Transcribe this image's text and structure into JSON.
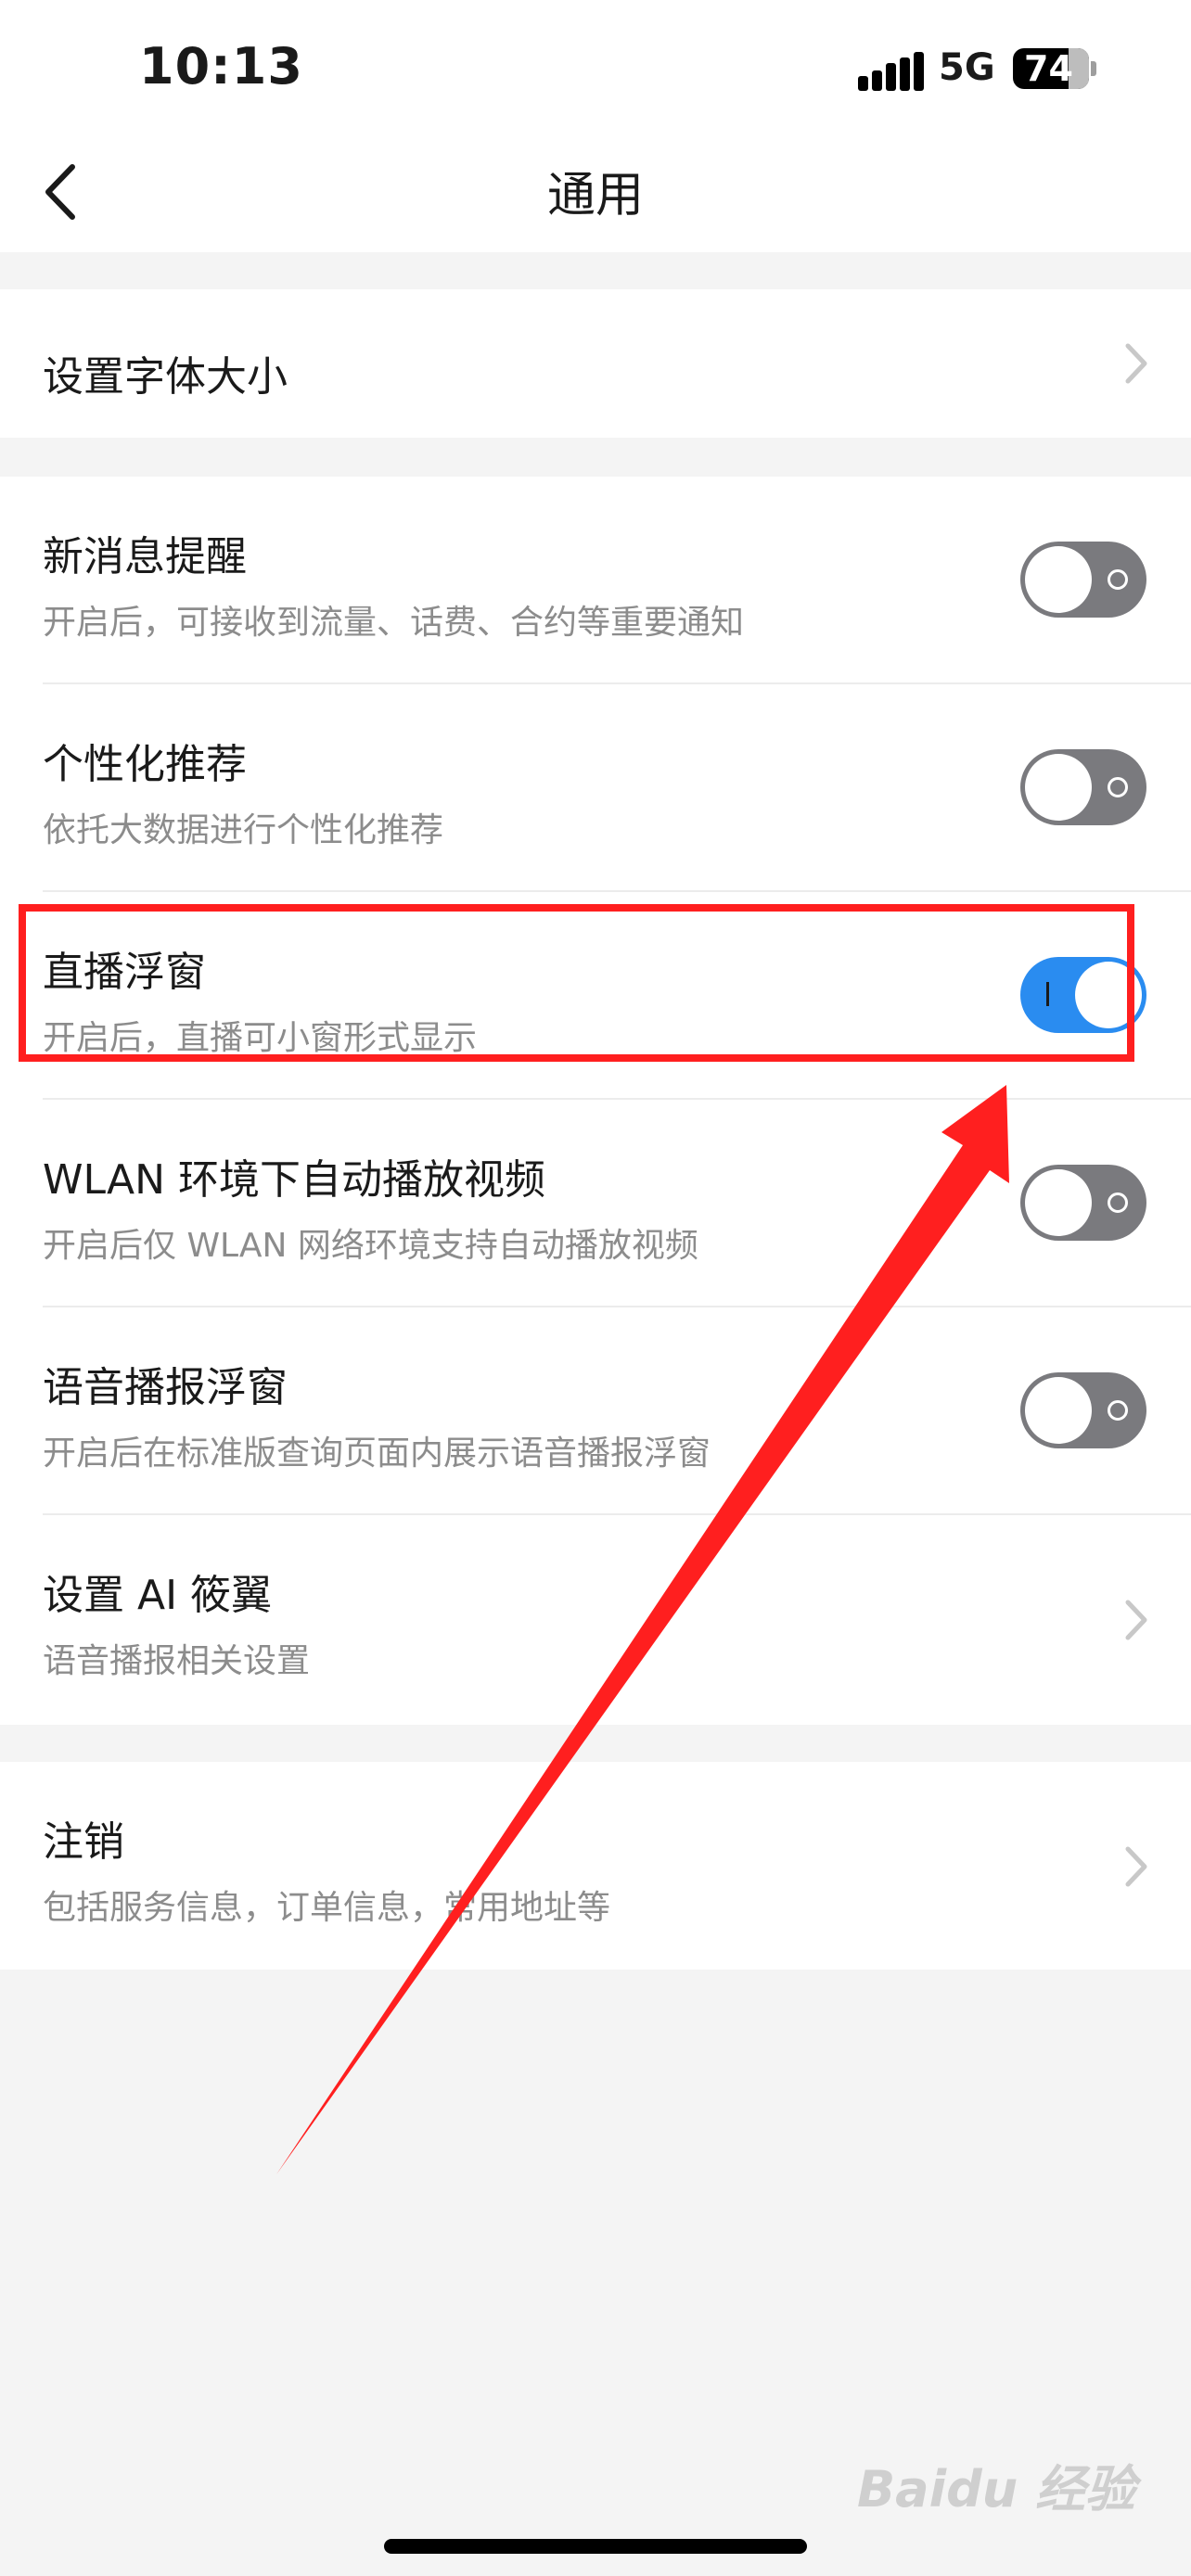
{
  "status_bar": {
    "time": "10:13",
    "network": "5G",
    "battery": "74"
  },
  "nav": {
    "title": "通用",
    "back_icon": "chevron-left-icon"
  },
  "groups": [
    {
      "items": [
        {
          "title": "设置字体大小",
          "control": "chevron"
        }
      ]
    },
    {
      "items": [
        {
          "title": "新消息提醒",
          "subtitle": "开启后，可接收到流量、话费、合约等重要通知",
          "control": "toggle",
          "on": false
        },
        {
          "title": "个性化推荐",
          "subtitle": "依托大数据进行个性化推荐",
          "control": "toggle",
          "on": false
        },
        {
          "title": "直播浮窗",
          "subtitle": "开启后，直播可小窗形式显示",
          "control": "toggle",
          "on": true
        },
        {
          "title": "WLAN 环境下自动播放视频",
          "subtitle": "开启后仅 WLAN 网络环境支持自动播放视频",
          "control": "toggle",
          "on": false
        },
        {
          "title": "语音播报浮窗",
          "subtitle": "开启后在标准版查询页面内展示语音播报浮窗",
          "control": "toggle",
          "on": false
        },
        {
          "title": "设置 AI 筱翼",
          "subtitle": "语音播报相关设置",
          "control": "chevron"
        }
      ]
    },
    {
      "items": [
        {
          "title": "注销",
          "subtitle": "包括服务信息，订单信息，常用地址等",
          "control": "chevron"
        }
      ]
    }
  ],
  "colors": {
    "toggle_on": "#2a8cf0",
    "toggle_off": "#7a7a7e",
    "annotation": "#ff1f1f",
    "page_background": "#f4f4f4"
  },
  "watermark": "Baidu 经验"
}
